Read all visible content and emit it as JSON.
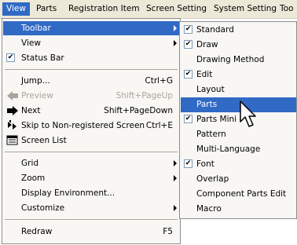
{
  "menubar": {
    "items": [
      {
        "label": "View"
      },
      {
        "label": "Parts"
      },
      {
        "label": "Registration Item"
      },
      {
        "label": "Screen Setting"
      },
      {
        "label": "System Setting"
      },
      {
        "label": "Too"
      }
    ]
  },
  "view_menu": {
    "toolbar": "Toolbar",
    "view": "View",
    "status_bar": "Status Bar",
    "jump": "Jump...",
    "jump_shortcut": "Ctrl+G",
    "preview": "Preview",
    "preview_shortcut": "Shift+PageUp",
    "next": "Next",
    "next_shortcut": "Shift+PageDown",
    "skip": "Skip to Non-registered Screen",
    "skip_shortcut": "Ctrl+E",
    "screen_list": "Screen List",
    "grid": "Grid",
    "zoom": "Zoom",
    "display_env": "Display Environment...",
    "customize": "Customize",
    "redraw": "Redraw",
    "redraw_shortcut": "F5"
  },
  "toolbar_submenu": {
    "items": [
      {
        "label": "Standard",
        "checked": true
      },
      {
        "label": "Draw",
        "checked": true
      },
      {
        "label": "Drawing Method",
        "checked": false
      },
      {
        "label": "Edit",
        "checked": true
      },
      {
        "label": "Layout",
        "checked": false
      },
      {
        "label": "Parts",
        "checked": false
      },
      {
        "label": "Parts Mini",
        "checked": true
      },
      {
        "label": "Pattern",
        "checked": false
      },
      {
        "label": "Multi-Language",
        "checked": false
      },
      {
        "label": "Font",
        "checked": true
      },
      {
        "label": "Overlap",
        "checked": false
      },
      {
        "label": "Component Parts Edit",
        "checked": false
      },
      {
        "label": "Macro",
        "checked": false
      }
    ]
  },
  "colors": {
    "highlight": "#316ac5",
    "menubar_bg": "#ece9d8",
    "disabled_text": "#a7a59c"
  }
}
